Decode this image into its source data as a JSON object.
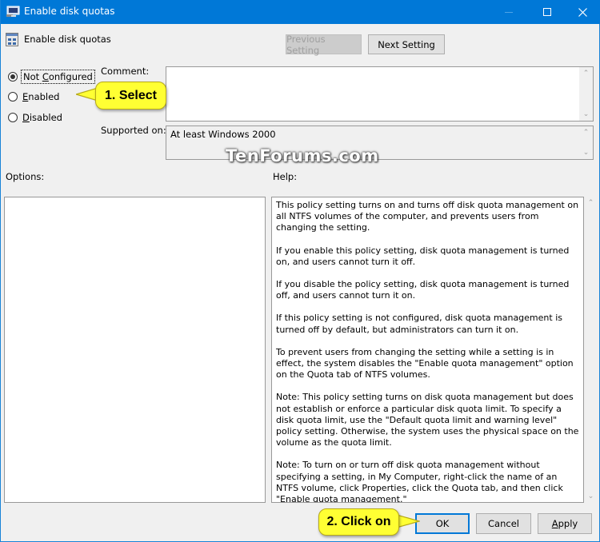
{
  "window": {
    "title": "Enable disk quotas",
    "controls": {
      "minimize": "minimize",
      "maximize": "maximize",
      "close": "close"
    }
  },
  "header": {
    "policy_name": "Enable disk quotas",
    "prev_button": "Previous Setting",
    "next_button": "Next Setting"
  },
  "state": {
    "options": [
      {
        "label": "Not Configured",
        "accel": "C",
        "checked": true
      },
      {
        "label": "Enabled",
        "accel": "E",
        "checked": false
      },
      {
        "label": "Disabled",
        "accel": "D",
        "checked": false
      }
    ],
    "selected": "Not Configured"
  },
  "comment": {
    "label": "Comment:",
    "value": ""
  },
  "supported": {
    "label": "Supported on:",
    "value": "At least Windows 2000"
  },
  "sections": {
    "options_label": "Options:",
    "help_label": "Help:"
  },
  "help_paragraphs": [
    "This policy setting turns on and turns off disk quota management on all NTFS volumes of the computer, and prevents users from changing the setting.",
    "If you enable this policy setting, disk quota management is turned on, and users cannot turn it off.",
    "If you disable the policy setting, disk quota management is turned off, and users cannot turn it on.",
    "If this policy setting is not configured, disk quota management is turned off by default, but administrators can turn it on.",
    "To prevent users from changing the setting while a setting is in effect, the system disables the \"Enable quota management\" option on the Quota tab of NTFS volumes.",
    "Note: This policy setting turns on disk quota management but does not establish or enforce a particular disk quota limit. To specify a disk quota limit, use the \"Default quota limit and warning level\" policy setting. Otherwise, the system uses the physical space on the volume as the quota limit.",
    "Note: To turn on or turn off disk quota management without specifying a setting, in My Computer, right-click the name of an NTFS volume, click Properties, click the Quota tab, and then click \"Enable quota management.\""
  ],
  "footer": {
    "ok": "OK",
    "cancel": "Cancel",
    "apply": "Apply"
  },
  "annotations": {
    "callout1": "1. Select",
    "callout2": "2. Click on",
    "watermark": "TenForums.com"
  },
  "colors": {
    "titlebar": "#0078d7",
    "callout": "#ffff33",
    "accent": "#0078d7"
  }
}
